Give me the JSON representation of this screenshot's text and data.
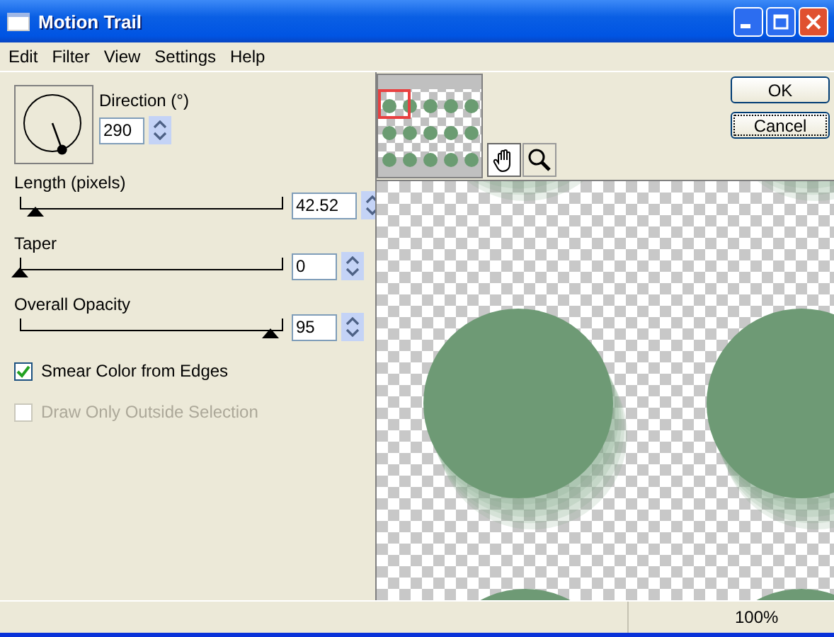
{
  "window": {
    "title": "Motion Trail"
  },
  "menu": [
    "Edit",
    "Filter",
    "View",
    "Settings",
    "Help"
  ],
  "direction": {
    "label": "Direction (°)",
    "value": "290"
  },
  "sliders": [
    {
      "label": "Length (pixels)",
      "value": "42.52",
      "level": 0.06,
      "kind": "wide"
    },
    {
      "label": "Taper",
      "value": "0",
      "level": 0,
      "kind": "narrow"
    },
    {
      "label": "Overall Opacity",
      "value": "95",
      "level": 0.95,
      "kind": "narrow"
    }
  ],
  "checkboxes": [
    {
      "label": "Smear Color from Edges",
      "checked": true,
      "disabled": false
    },
    {
      "label": "Draw Only Outside Selection",
      "checked": false,
      "disabled": true
    }
  ],
  "tools": [
    {
      "kind": "hand",
      "selected": true
    },
    {
      "kind": "zoom",
      "selected": false
    }
  ],
  "buttons": [
    {
      "label": "OK",
      "focused": false
    },
    {
      "label": "Cancel",
      "focused": true
    }
  ],
  "status_bar": {
    "zoom": "100%"
  }
}
